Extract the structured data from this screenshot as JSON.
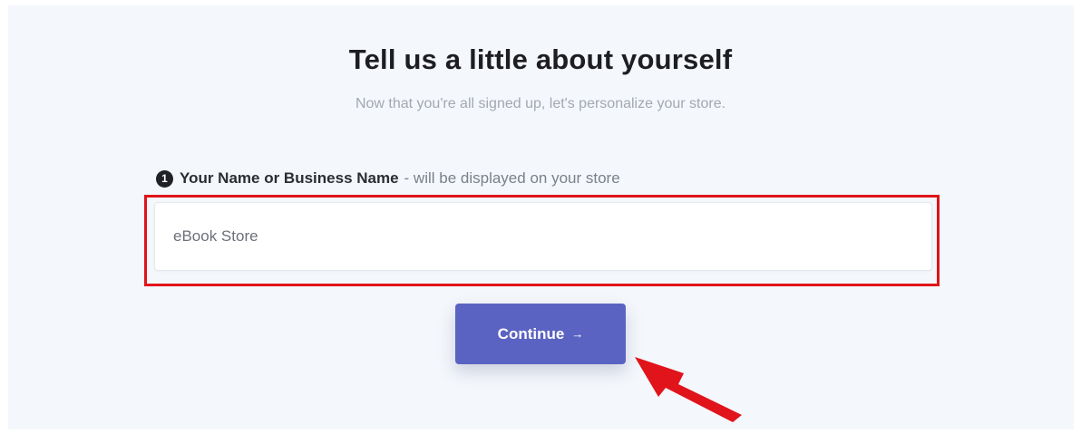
{
  "header": {
    "title": "Tell us a little about yourself",
    "subtitle": "Now that you're all signed up, let's personalize your store."
  },
  "form": {
    "step_number": "1",
    "label_strong": "Your Name or Business Name",
    "label_hint": "- will be displayed on your store",
    "name_value": "eBook Store"
  },
  "actions": {
    "continue_label": "Continue",
    "continue_arrow": "→"
  },
  "colors": {
    "accent": "#5b63c2",
    "highlight": "#e0141a",
    "background": "#f4f7fb"
  }
}
